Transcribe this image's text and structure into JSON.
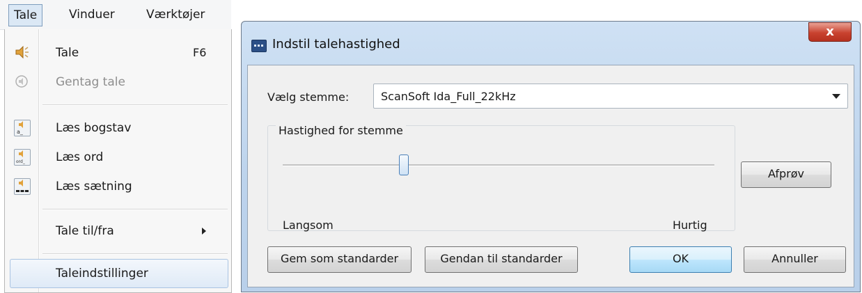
{
  "menubar": {
    "items": [
      "Tale",
      "Vinduer",
      "Værktøjer"
    ]
  },
  "menu": {
    "items": [
      {
        "label": "Tale",
        "shortcut": "F6",
        "icon": "speaker-icon",
        "enabled": true
      },
      {
        "label": "Gentag tale",
        "icon": "repeat-speech-icon",
        "enabled": false
      },
      {
        "label": "Læs bogstav",
        "icon": "read-letter-icon",
        "enabled": true
      },
      {
        "label": "Læs ord",
        "icon": "read-word-icon",
        "enabled": true
      },
      {
        "label": "Læs sætning",
        "icon": "read-sentence-icon",
        "enabled": true
      },
      {
        "label": "Tale til/fra",
        "icon": "submenu-arrow-icon",
        "enabled": true
      },
      {
        "label": "Taleindstillinger",
        "enabled": true,
        "highlighted": true
      }
    ]
  },
  "dialog": {
    "title": "Indstil talehastighed",
    "close_label": "x",
    "voice_label": "Vælg stemme:",
    "voice_value": "ScanSoft Ida_Full_22kHz",
    "speed_group_title": "Hastighed for stemme",
    "slow_label": "Langsom",
    "fast_label": "Hurtig",
    "speed_fraction": 0.28,
    "buttons": {
      "test": "Afprøv",
      "save_defaults": "Gem som standarder",
      "restore_defaults": "Gendan til standarder",
      "ok": "OK",
      "cancel": "Annuller"
    }
  }
}
